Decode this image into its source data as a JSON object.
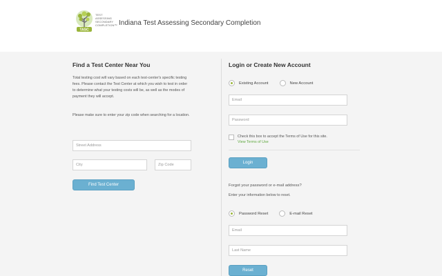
{
  "header": {
    "logo_lines": [
      "TEST",
      "ASSESSING",
      "SECONDARY",
      "COMPLETION™"
    ],
    "logo_badge": "TASC",
    "title": "Indiana Test Assessing Secondary Completion"
  },
  "find": {
    "heading": "Find a Test Center Near You",
    "para1_lines": [
      "Total testing cost will vary based on each test-center's specific testing",
      "fees.  Please contact the Test Center at which you wish to test in order",
      "to determine what your testing costs will be, as well as the modes of",
      "payment they will accept."
    ],
    "para2": "Please make sure to enter your zip code when searching for a location.",
    "street_placeholder": "Street Address",
    "city_placeholder": "City",
    "zip_placeholder": "Zip Code",
    "button": "Find Test Center"
  },
  "login": {
    "heading": "Login or Create New Account",
    "radio_existing": "Existing Account",
    "radio_new": "New Account",
    "email_placeholder": "Email",
    "password_placeholder": "Password",
    "terms_text": "Check this box to accept the Terms of Use for this site.",
    "terms_link": "View Terms of Use",
    "button": "Login"
  },
  "reset": {
    "forgot_text": "Forgot your password or e-mail address?",
    "instructions": "Enter your information below to reset.",
    "radio_password": "Password Reset",
    "radio_email": "E-mail Reset",
    "email_placeholder": "Email",
    "lastname_placeholder": "Last Name",
    "button": "Reset"
  },
  "colors": {
    "accent_button": "#6bb0d1",
    "radio_selected": "#9ab53a",
    "link": "#5fa83f",
    "panel_bg": "#f4f4f4"
  }
}
